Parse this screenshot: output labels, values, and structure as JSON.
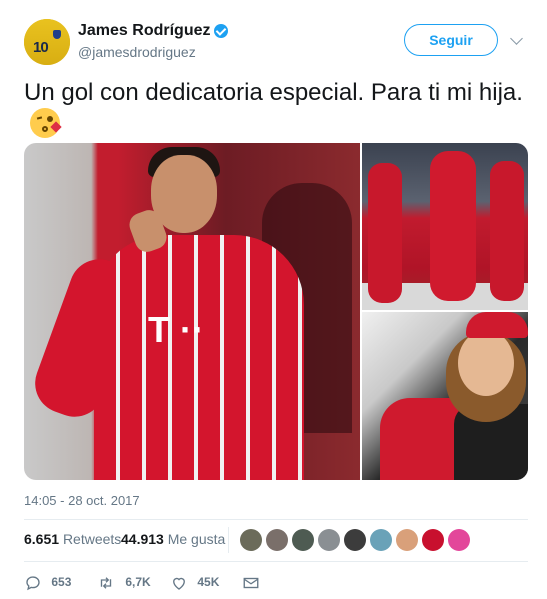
{
  "header": {
    "display_name": "James Rodríguez",
    "handle": "@jamesdrodriguez",
    "avatar_number": "10",
    "follow_label": "Seguir"
  },
  "tweet": {
    "text": "Un gol con dedicatoria especial. Para ti mi hija.",
    "emoji": "face-blowing-kiss"
  },
  "timestamp": "14:05 - 28 oct. 2017",
  "stats": {
    "retweets_count": "6.651",
    "retweets_label": "Retweets",
    "likes_count": "44.913",
    "likes_label": "Me gusta"
  },
  "likers": [
    {
      "color": "#6b6b5a"
    },
    {
      "color": "#7a6f6a"
    },
    {
      "color": "#4e5b52"
    },
    {
      "color": "#8a8f93"
    },
    {
      "color": "#3c3c3c"
    },
    {
      "color": "#6aa2b8"
    },
    {
      "color": "#d9a07a"
    },
    {
      "color": "#c8102e"
    },
    {
      "color": "#e3469a"
    }
  ],
  "actions": {
    "reply_count": "653",
    "retweet_count": "6,7K",
    "like_count": "45K"
  },
  "colors": {
    "accent": "#1da1f2",
    "muted_text": "#657786",
    "divider": "#e6ecf0"
  }
}
